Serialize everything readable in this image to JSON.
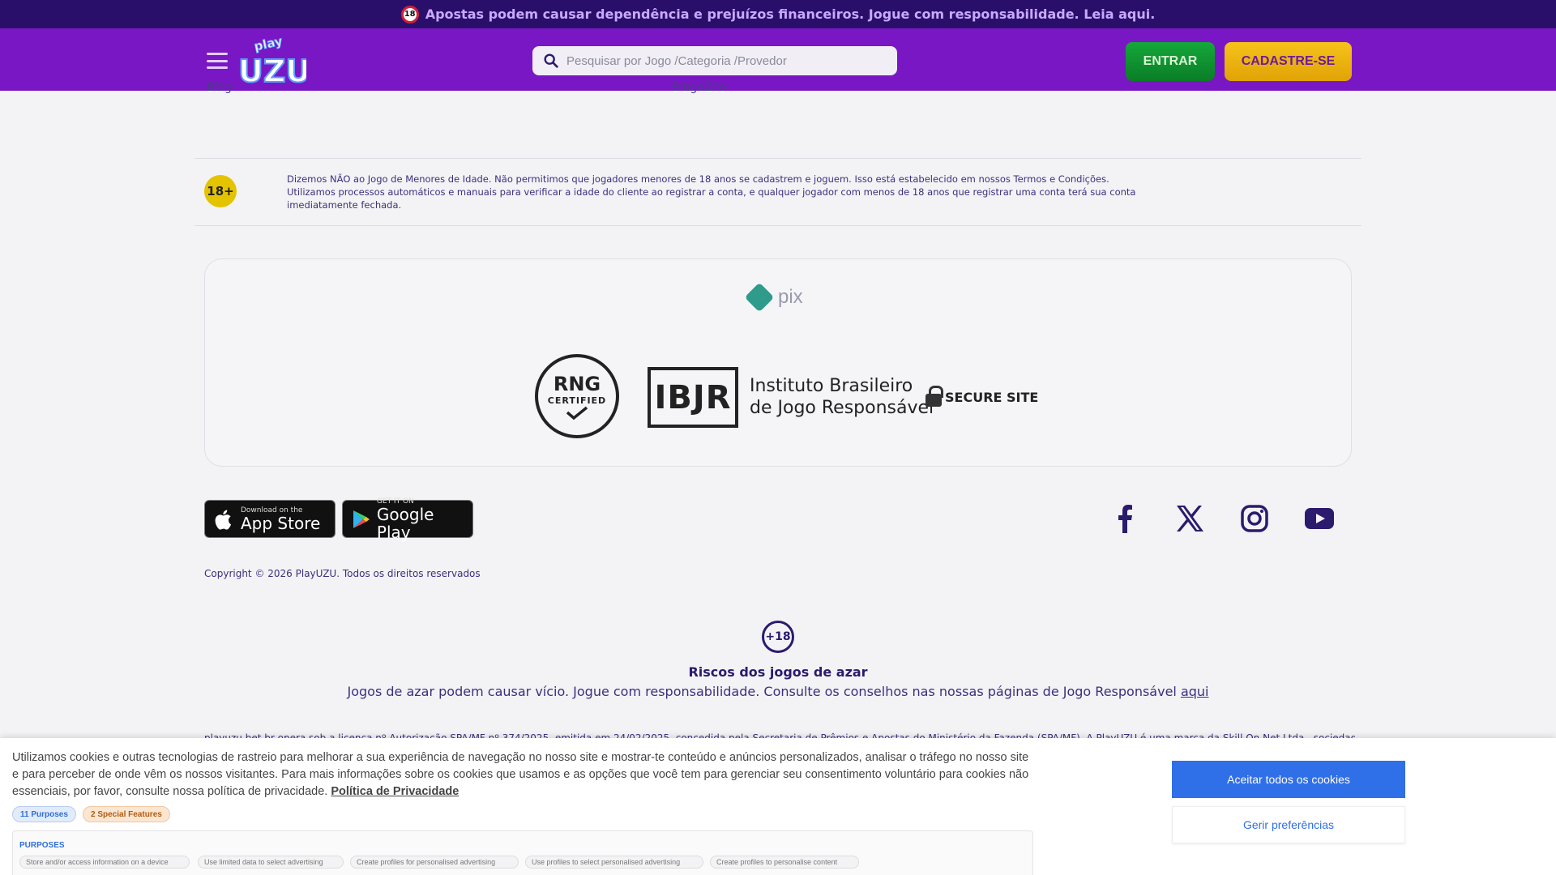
{
  "warning_banner": {
    "badge": "18",
    "text": "Apostas podem causar dependência e prejuízos financeiros. Jogue com responsabilidade.  Leia aqui."
  },
  "header": {
    "logo_text_top": "play",
    "logo_text_main": "UZU",
    "search_placeholder": "Pesquisar por Jogo /Categoria /Provedor",
    "login_label": "ENTRAR",
    "register_label": "CADASTRE-SE"
  },
  "footer_links_cut": [
    "Blog",
    "BingoZoo"
  ],
  "age_notice": {
    "badge": "18+",
    "line1": "Dizemos NÃO ao Jogo de Menores de Idade. Não permitimos que jogadores menores de 18 anos se cadastrem e joguem. Isso está estabelecido em nossos Termos e Condições.",
    "line2": "Utilizamos processos automáticos e manuais para verificar a idade do cliente ao registrar a conta, e qualquer jogador com menos de 18 anos que registrar uma conta terá sua conta imediatamente fechada."
  },
  "certifications": {
    "pix": "pix",
    "rng_top": "RNG",
    "rng_bottom": "CERTIFIED",
    "ibjr_box": "IBJR",
    "ibjr_line1": "Instituto Brasileiro",
    "ibjr_line2": "de Jogo Responsável",
    "secure": "SECURE SITE"
  },
  "stores": {
    "apple_small": "Download on the",
    "apple_big": "App Store",
    "google_small": "GET IT ON",
    "google_big": "Google Play"
  },
  "social_icons": [
    "facebook-icon",
    "x-icon",
    "instagram-icon",
    "youtube-icon"
  ],
  "copyright": "Copyright © 2026 PlayUZU. Todos os direitos reservados",
  "risk": {
    "icon": "+18",
    "title": "Riscos dos jogos de azar",
    "text": "Jogos de azar podem causar vício. Jogue com responsabilidade. Consulte os conselhos nas nossas páginas de Jogo Responsável ",
    "link": "aqui"
  },
  "license_text": "playuzu.bet.br opera sob a licença nº Autorização SPA/MF nº 374/2025, emitida em 24/02/2025, concedida pela Secretaria de Prêmios e Apostas do Ministério da Fazenda (SPA/MF). A PlayUZU é uma marca da Skill On Net Ltda., sociedade limitada inscrita",
  "cookie": {
    "text": "Utilizamos cookies e outras tecnologias de rastreio para melhorar a sua experiência de navegação no nosso site e mostrar-te conteúdo e anúncios personalizados, analisar o tráfego no nosso site e para perceber de onde vêm os nossos visitantes. Para mais informações sobre os cookies que usamos e as opções que você tem para gerenciar seu consentimento voluntário para cookies não essenciais, por favor, consulte nossa política de privacidade. ",
    "policy_link": "Política de Privacidade",
    "purposes_pill": "11 Purposes",
    "special_pill": "2 Special Features",
    "purposes_header": "PURPOSES",
    "tags": [
      "Store and/or access information on a device",
      "Use limited data to select advertising",
      "Create profiles for personalised advertising",
      "Use profiles to select personalised advertising",
      "Create profiles to personalise content"
    ],
    "accept_label": "Aceitar todos os cookies",
    "manage_label": "Gerir preferências"
  },
  "colors": {
    "header_purple": "#7a17c4",
    "banner_navy": "#2a0f6a",
    "login_green": "#0b7d27",
    "register_yellow": "#f6c31a",
    "cookie_blue": "#2f6fe8"
  }
}
